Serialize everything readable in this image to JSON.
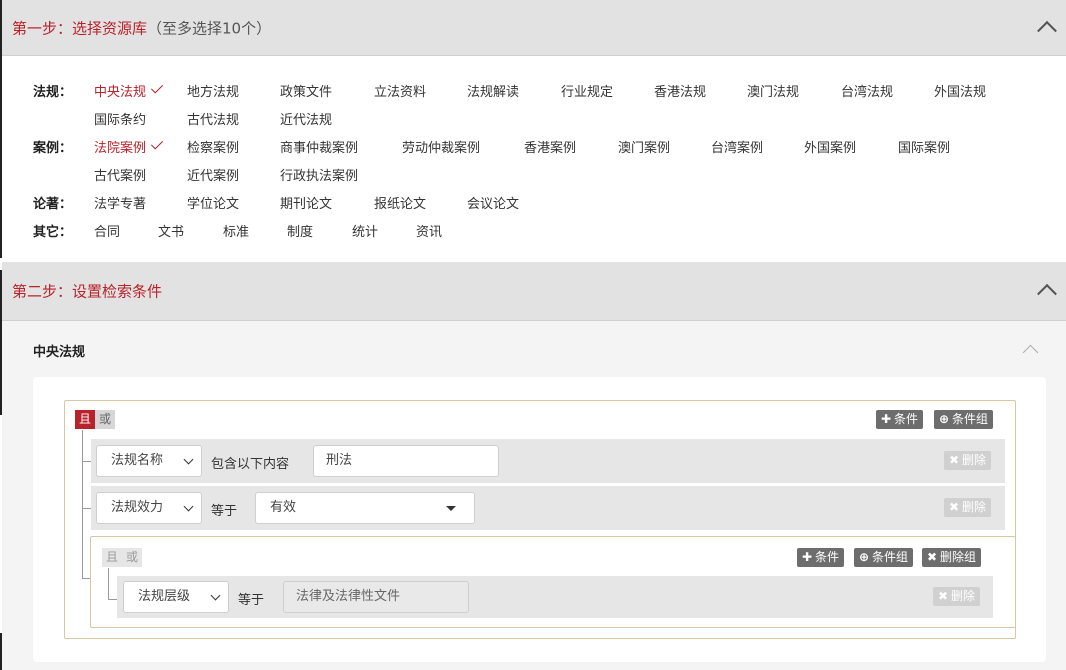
{
  "step1": {
    "title": "第一步：选择资源库",
    "hint": "（至多选择10个）"
  },
  "categories": {
    "law": {
      "label": "法规：",
      "options": [
        "中央法规",
        "地方法规",
        "政策文件",
        "立法资料",
        "法规解读",
        "行业规定",
        "香港法规",
        "澳门法规",
        "台湾法规",
        "外国法规",
        "国际条约",
        "古代法规",
        "近代法规"
      ],
      "selected": "中央法规"
    },
    "case": {
      "label": "案例：",
      "options": [
        "法院案例",
        "检察案例",
        "商事仲裁案例",
        "劳动仲裁案例",
        "香港案例",
        "澳门案例",
        "台湾案例",
        "外国案例",
        "国际案例",
        "古代案例",
        "近代案例",
        "行政执法案例"
      ],
      "selected": "法院案例"
    },
    "works": {
      "label": "论著：",
      "options": [
        "法学专著",
        "学位论文",
        "期刊论文",
        "报纸论文",
        "会议论文"
      ]
    },
    "other": {
      "label": "其它：",
      "options": [
        "合同",
        "文书",
        "标准",
        "制度",
        "统计",
        "资讯"
      ]
    }
  },
  "step2": {
    "title": "第二步：设置检索条件",
    "section": "中央法规"
  },
  "conditions": {
    "and": "且",
    "or": "或",
    "add_condition": "条件",
    "add_group": "条件组",
    "delete": "删除",
    "delete_group": "删除组",
    "rows": [
      {
        "field": "法规名称",
        "op": "包含以下内容",
        "value": "刑法"
      },
      {
        "field": "法规效力",
        "op": "等于",
        "value": "有效"
      }
    ],
    "inner_rows": [
      {
        "field": "法规层级",
        "op": "等于",
        "value": "法律及法律性文件"
      }
    ]
  }
}
